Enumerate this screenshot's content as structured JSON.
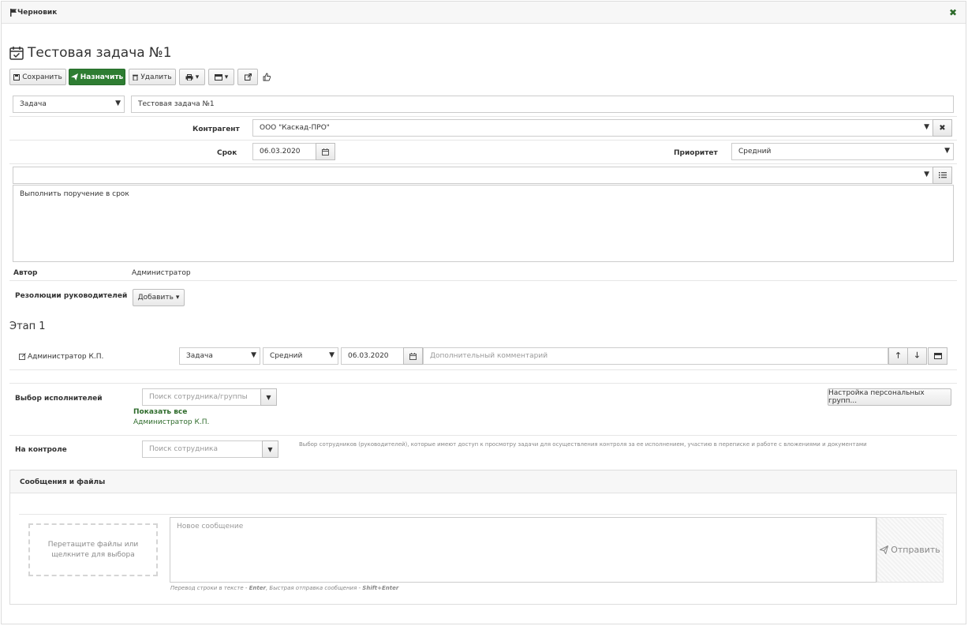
{
  "window": {
    "title": "Черновик",
    "close_symbol": "✖"
  },
  "page": {
    "title": "Тестовая задача №1"
  },
  "toolbar": {
    "save_label": "Сохранить",
    "assign_label": "Назначить",
    "delete_label": "Удалить"
  },
  "task": {
    "type_value": "Задача",
    "name_value": "Тестовая задача №1",
    "counterparty_label": "Контрагент",
    "counterparty_value": "ООО \"Каскад-ПРО\"",
    "due_label": "Срок",
    "due_value": "06.03.2020",
    "priority_label": "Приоритет",
    "priority_value": "Средний",
    "description": "Выполнить поручение в срок"
  },
  "author": {
    "label": "Автор",
    "value": "Администратор"
  },
  "resolutions": {
    "label": "Резолюции руководителей",
    "add_label": "Добавить"
  },
  "stage": {
    "title": "Этап 1",
    "assignee": "Администратор К.П.",
    "type_value": "Задача",
    "priority_value": "Средний",
    "date_value": "06.03.2020",
    "comment_placeholder": "Дополнительный комментарий"
  },
  "executors": {
    "label": "Выбор исполнителей",
    "search_placeholder": "Поиск сотрудника/группы",
    "show_all": "Показать все",
    "selected": "Администратор К.П.",
    "personal_groups_label": "Настройка персональных групп..."
  },
  "control": {
    "label": "На контроле",
    "search_placeholder": "Поиск сотрудника",
    "description": "Выбор сотрудников (руководителей), которые имеют доступ к просмотру задачи для осуществления контроля за ее исполнением, участию в переписке и работе с вложениями и документами"
  },
  "messages": {
    "header": "Сообщения и файлы",
    "drop_line1": "Перетащите файлы или",
    "drop_line2": "щелкните для выбора",
    "new_message_placeholder": "Новое сообщение",
    "send_label": "Отправить",
    "hint_prefix": "Перевод строки в тексте - ",
    "hint_enter": "Enter",
    "hint_middle": ", Быстрая отправка сообщения - ",
    "hint_shift_enter": "Shift+Enter"
  },
  "colors": {
    "accent_green": "#2e7d32",
    "link_green": "#2e6b2b",
    "border": "#cccccc"
  }
}
